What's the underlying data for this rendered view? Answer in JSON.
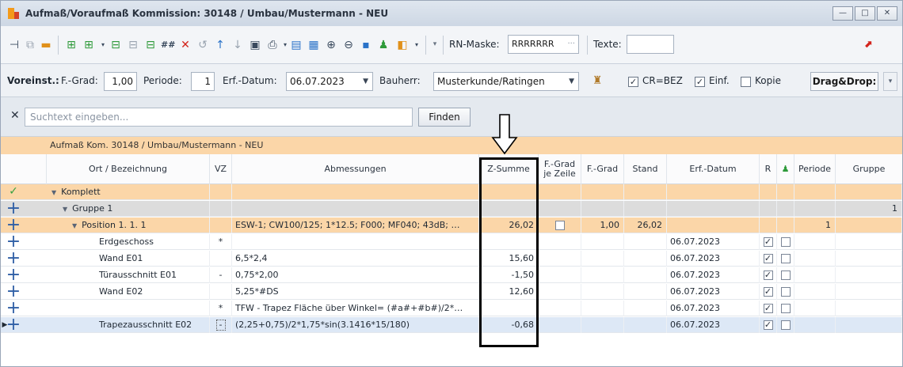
{
  "window": {
    "title": "Aufmaß/Voraufmaß Kommission: 30148 / Umbau/Mustermann - NEU",
    "controls": {
      "minimize": "—",
      "maximize": "□",
      "close": "✕"
    }
  },
  "toolbar1": {
    "rn_mask_label": "RN-Maske:",
    "rn_mask_value": "RRRRRRR",
    "rn_mask_dots": "···",
    "texte_label": "Texte:",
    "grid_icon_label": "##"
  },
  "toolbar2": {
    "voreinst_label": "Voreinst.:",
    "fgrad_label": "F.-Grad:",
    "fgrad_value": "1,00",
    "periode_label": "Periode:",
    "periode_value": "1",
    "erf_datum_label": "Erf.-Datum:",
    "erf_datum_value": "06.07.2023",
    "bauherr_label": "Bauherr:",
    "bauherr_value": "Musterkunde/Ratingen",
    "cr_bez_label": "CR=BEZ",
    "einf_label": "Einf.",
    "kopie_label": "Kopie",
    "dragdrop_label": "Drag&Drop:"
  },
  "search": {
    "placeholder": "Suchtext eingeben...",
    "find_label": "Finden"
  },
  "grid": {
    "caption": "Aufmaß Kom. 30148 / Umbau/Mustermann - NEU",
    "columns": {
      "ort": "Ort / Bezeichnung",
      "vz": "VZ",
      "abmessungen": "Abmessungen",
      "zsumme": "Z-Summe",
      "fgrad_je_zeile_1": "F.-Grad",
      "fgrad_je_zeile_2": "je Zeile",
      "fgrad": "F.-Grad",
      "stand": "Stand",
      "erf_datum": "Erf.-Datum",
      "r": "R",
      "periode": "Periode",
      "gruppe": "Gruppe"
    },
    "rows": [
      {
        "kind": "komplett",
        "ort": "Komplett",
        "vz": "",
        "abm": "",
        "zsum": "",
        "fgrad": "",
        "stand": "",
        "datum": "",
        "periode": "",
        "gruppe": ""
      },
      {
        "kind": "gruppe",
        "ort": "Gruppe 1",
        "vz": "",
        "abm": "",
        "zsum": "",
        "fgrad": "",
        "stand": "",
        "datum": "",
        "periode": "",
        "gruppe": "1"
      },
      {
        "kind": "position",
        "ort": "Position  1. 1.  1",
        "vz": "",
        "abm": "ESW-1; CW100/125; 1*12.5; F000; MF040; 43dB; …",
        "zsum": "26,02",
        "fgrad": "1,00",
        "stand": "26,02",
        "datum": "",
        "periode": "1",
        "gruppe": ""
      },
      {
        "kind": "item",
        "ort": "Erdgeschoss",
        "vz": "*",
        "abm": "",
        "zsum": "",
        "fgrad": "",
        "stand": "",
        "datum": "06.07.2023",
        "periode": "",
        "gruppe": ""
      },
      {
        "kind": "item",
        "ort": "Wand E01",
        "vz": "",
        "abm": "6,5*2,4",
        "zsum": "15,60",
        "fgrad": "",
        "stand": "",
        "datum": "06.07.2023",
        "periode": "",
        "gruppe": ""
      },
      {
        "kind": "item",
        "ort": "Türausschnitt E01",
        "vz": "-",
        "abm": "0,75*2,00",
        "zsum": "-1,50",
        "fgrad": "",
        "stand": "",
        "datum": "06.07.2023",
        "periode": "",
        "gruppe": ""
      },
      {
        "kind": "item",
        "ort": "Wand E02",
        "vz": "",
        "abm": "5,25*#DS",
        "zsum": "12,60",
        "fgrad": "",
        "stand": "",
        "datum": "06.07.2023",
        "periode": "",
        "gruppe": ""
      },
      {
        "kind": "item",
        "ort": "",
        "vz": "*",
        "abm": "TFW - Trapez Fläche über Winkel= (#a#+#b#)/2*…",
        "zsum": "",
        "fgrad": "",
        "stand": "",
        "datum": "06.07.2023",
        "periode": "",
        "gruppe": ""
      },
      {
        "kind": "selected",
        "ort": "Trapezausschnitt E02",
        "vz": "-",
        "abm": "(2,25+0,75)/2*1,75*sin(3.1416*15/180)",
        "zsum": "-0,68",
        "fgrad": "",
        "stand": "",
        "datum": "06.07.2023",
        "periode": "",
        "gruppe": ""
      }
    ]
  },
  "colors": {
    "accent_orange": "#fbd6a8",
    "group_gray": "#dcdcdc",
    "selection_blue": "#dde8f6",
    "plus_blue": "#2f5fa6",
    "check_green": "#37a040"
  }
}
